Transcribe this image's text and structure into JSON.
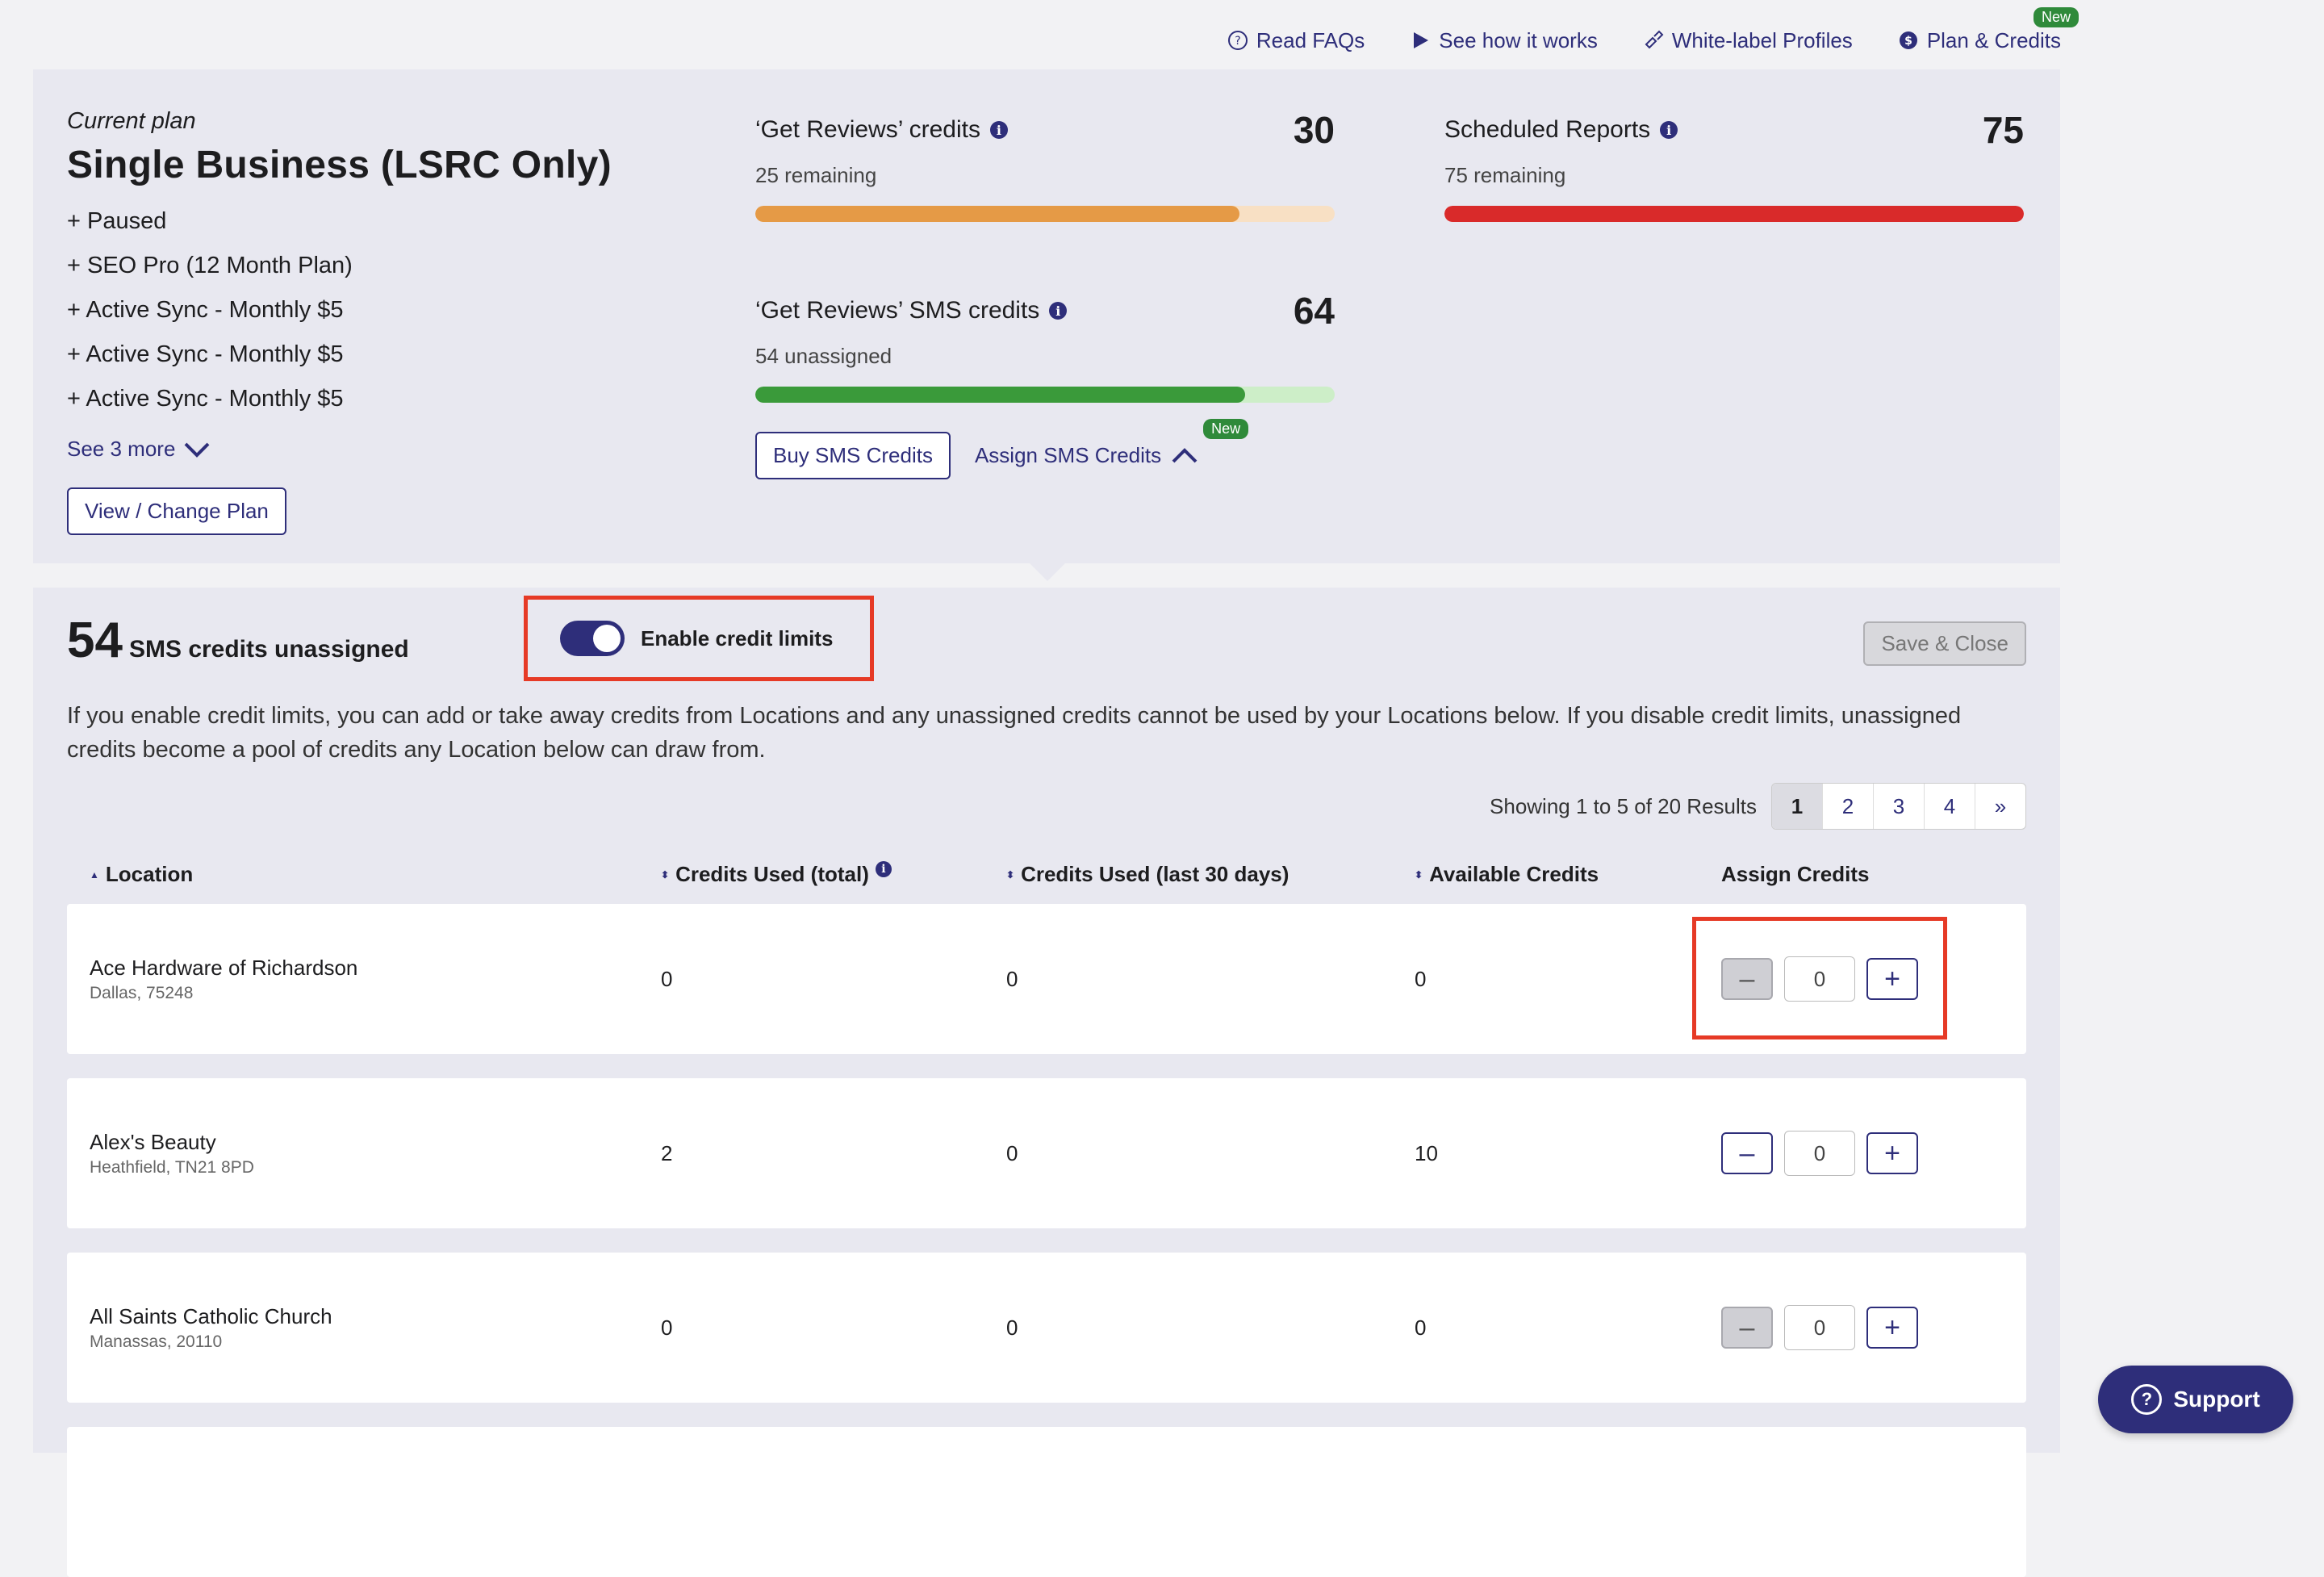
{
  "topnav": {
    "faqs": "Read FAQs",
    "how_it_works": "See how it works",
    "white_label": "White-label Profiles",
    "plan_credits": "Plan & Credits",
    "new_badge": "New"
  },
  "plan": {
    "label": "Current plan",
    "name": "Single Business (LSRC Only)",
    "addons": [
      "+ Paused",
      "+ SEO Pro (12 Month Plan)",
      "+ Active Sync - Monthly $5",
      "+ Active Sync - Monthly $5",
      "+ Active Sync - Monthly $5"
    ],
    "see_more": "See 3 more",
    "change_button": "View / Change Plan"
  },
  "credits": {
    "reviews": {
      "name": "‘Get Reviews’ credits",
      "value": "30",
      "sub": "25 remaining",
      "fraction": 0.835,
      "color": "#e59a46",
      "track": "#f8e0c4"
    },
    "sms": {
      "name": "‘Get Reviews’ SMS credits",
      "value": "64",
      "sub": "54 unassigned",
      "fraction": 0.845,
      "color": "#3a9a3a",
      "track": "#cdeec8"
    },
    "reports": {
      "name": "Scheduled Reports",
      "value": "75",
      "sub": "75 remaining",
      "fraction": 1.0,
      "color": "#d92a2a",
      "track": "#f5c8c8"
    },
    "buy_sms": "Buy SMS Credits",
    "assign_sms": "Assign SMS Credits",
    "new_badge": "New"
  },
  "assign": {
    "count": "54",
    "count_label": "SMS credits unassigned",
    "toggle_label": "Enable credit limits",
    "toggle_on": true,
    "save_close": "Save & Close",
    "description": "If you enable credit limits, you can add or take away credits from Locations and any unassigned credits cannot be used by your Locations below. If you disable credit limits, unassigned credits become a pool of credits any Location below can draw from.",
    "results": "Showing 1 to 5 of 20 Results",
    "pages": [
      "1",
      "2",
      "3",
      "4",
      "»"
    ],
    "columns": {
      "location": "Location",
      "used_total": "Credits Used (total)",
      "used_30": "Credits Used (last 30 days)",
      "available": "Available Credits",
      "assign": "Assign Credits"
    },
    "rows": [
      {
        "name": "Ace Hardware of Richardson",
        "addr": "Dallas, 75248",
        "used_total": "0",
        "used_30": "0",
        "available": "0",
        "assign": "0"
      },
      {
        "name": "Alex's Beauty",
        "addr": "Heathfield, TN21 8PD",
        "used_total": "2",
        "used_30": "0",
        "available": "10",
        "assign": "0"
      },
      {
        "name": "All Saints Catholic Church",
        "addr": "Manassas, 20110",
        "used_total": "0",
        "used_30": "0",
        "available": "0",
        "assign": "0"
      }
    ]
  },
  "support": "Support"
}
